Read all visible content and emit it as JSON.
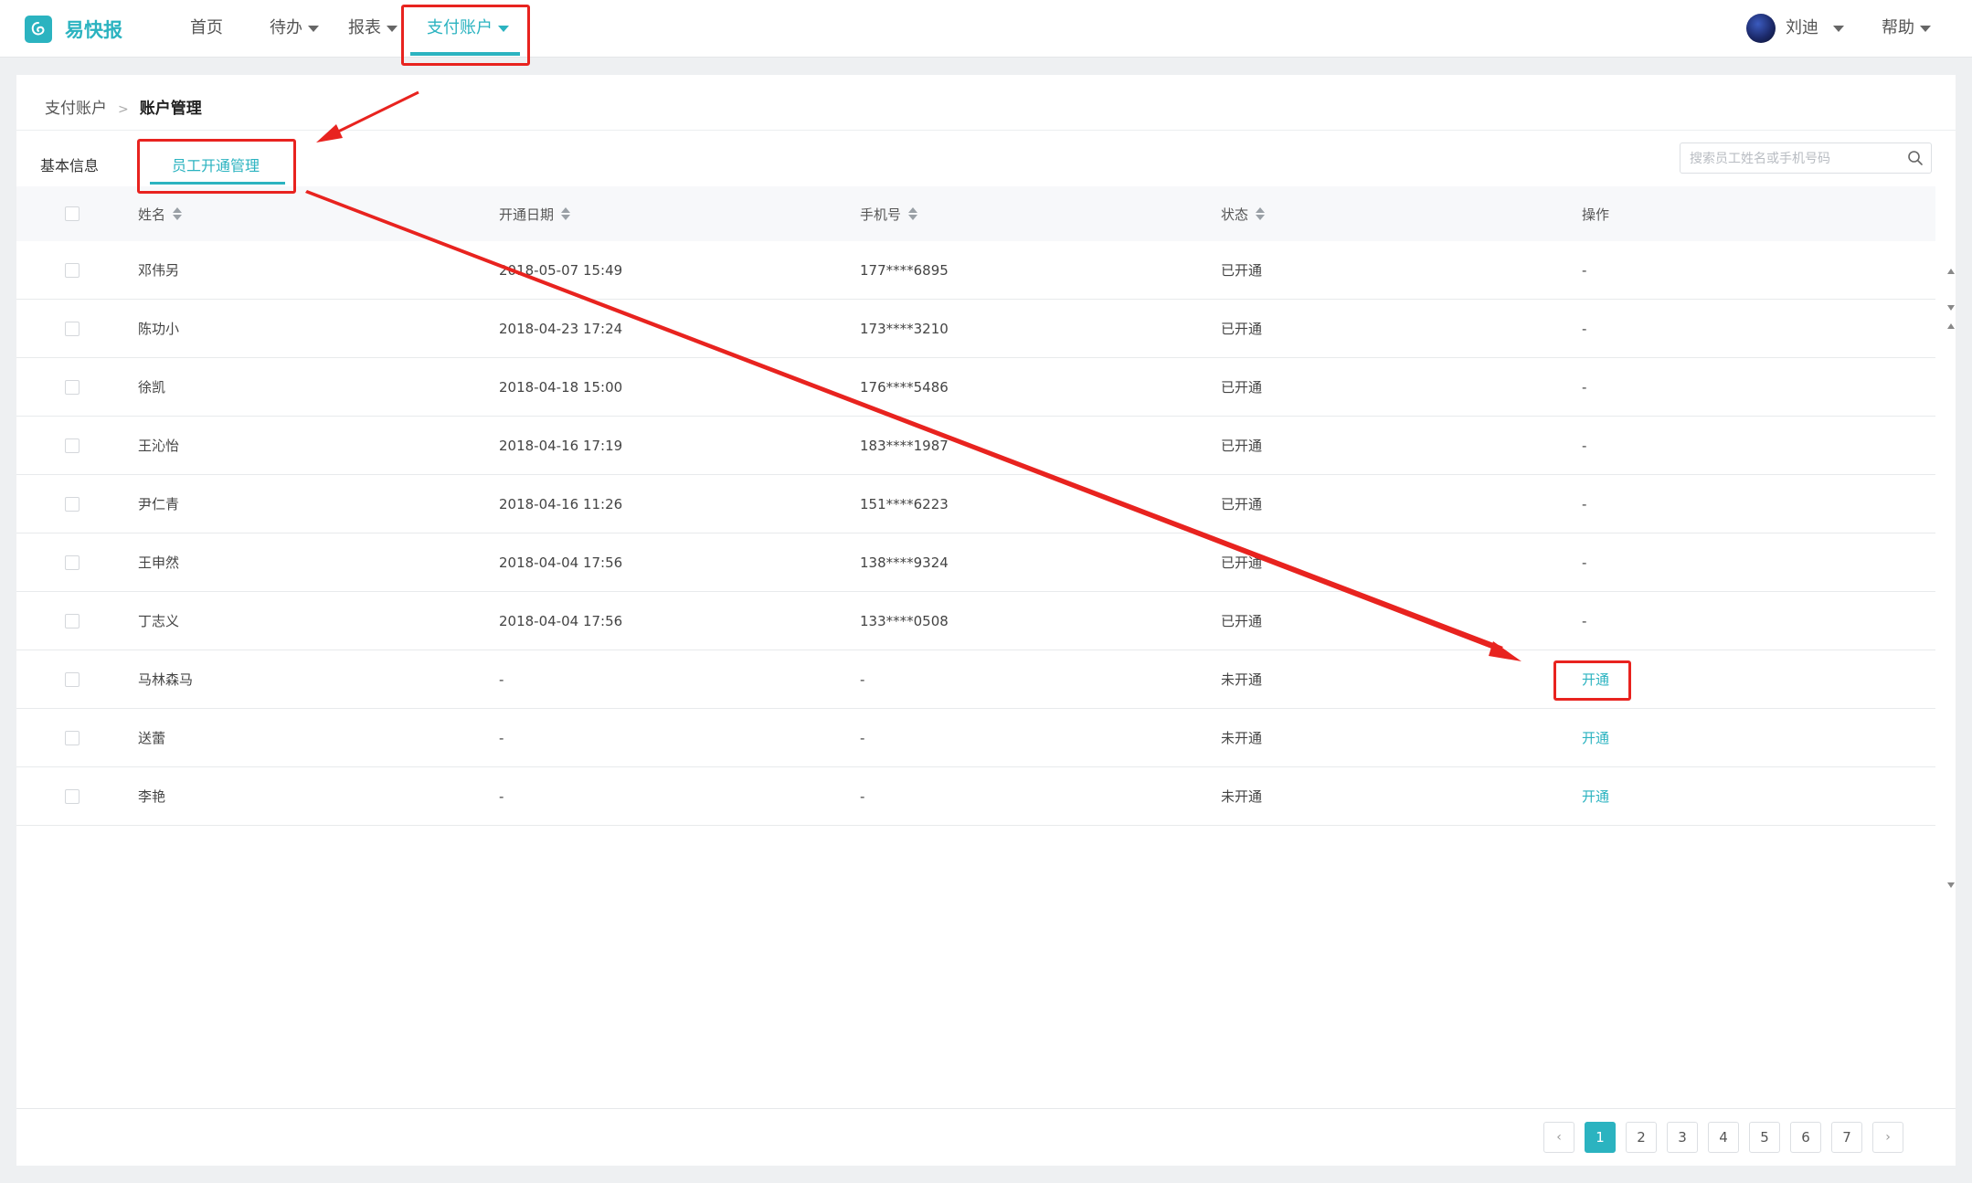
{
  "app": {
    "brand": "易快报",
    "nav": [
      {
        "label": "首页",
        "dropdown": false,
        "active": false
      },
      {
        "label": "待办",
        "dropdown": true,
        "active": false
      },
      {
        "label": "报表",
        "dropdown": true,
        "active": false
      },
      {
        "label": "支付账户",
        "dropdown": true,
        "active": true
      }
    ],
    "user_name": "刘迪",
    "help_label": "帮助",
    "accent_color": "#2bb3c0",
    "annotation_color": "#e8231f"
  },
  "breadcrumb": {
    "parent": "支付账户",
    "separator": ">",
    "current": "账户管理"
  },
  "tabs": [
    {
      "label": "基本信息",
      "active": false
    },
    {
      "label": "员工开通管理",
      "active": true
    }
  ],
  "search": {
    "placeholder": "搜索员工姓名或手机号码",
    "value": ""
  },
  "table": {
    "columns": [
      "姓名",
      "开通日期",
      "手机号",
      "状态",
      "操作"
    ],
    "rows": [
      {
        "name": "邓伟另",
        "date": "2018-05-07 15:49",
        "phone": "177****6895",
        "status": "已开通",
        "action": "-",
        "action_is_link": false
      },
      {
        "name": "陈功小",
        "date": "2018-04-23 17:24",
        "phone": "173****3210",
        "status": "已开通",
        "action": "-",
        "action_is_link": false
      },
      {
        "name": "徐凯",
        "date": "2018-04-18 15:00",
        "phone": "176****5486",
        "status": "已开通",
        "action": "-",
        "action_is_link": false
      },
      {
        "name": "王沁怡",
        "date": "2018-04-16 17:19",
        "phone": "183****1987",
        "status": "已开通",
        "action": "-",
        "action_is_link": false
      },
      {
        "name": "尹仁青",
        "date": "2018-04-16 11:26",
        "phone": "151****6223",
        "status": "已开通",
        "action": "-",
        "action_is_link": false
      },
      {
        "name": "王申然",
        "date": "2018-04-04 17:56",
        "phone": "138****9324",
        "status": "已开通",
        "action": "-",
        "action_is_link": false
      },
      {
        "name": "丁志义",
        "date": "2018-04-04 17:56",
        "phone": "133****0508",
        "status": "已开通",
        "action": "-",
        "action_is_link": false
      },
      {
        "name": "马林森马",
        "date": "-",
        "phone": "-",
        "status": "未开通",
        "action": "开通",
        "action_is_link": true
      },
      {
        "name": "送蕾",
        "date": "-",
        "phone": "-",
        "status": "未开通",
        "action": "开通",
        "action_is_link": true
      },
      {
        "name": "李艳",
        "date": "-",
        "phone": "-",
        "status": "未开通",
        "action": "开通",
        "action_is_link": true
      }
    ]
  },
  "pagination": {
    "prev": "‹",
    "next": "›",
    "pages": [
      "1",
      "2",
      "3",
      "4",
      "5",
      "6",
      "7"
    ],
    "current": "1"
  }
}
